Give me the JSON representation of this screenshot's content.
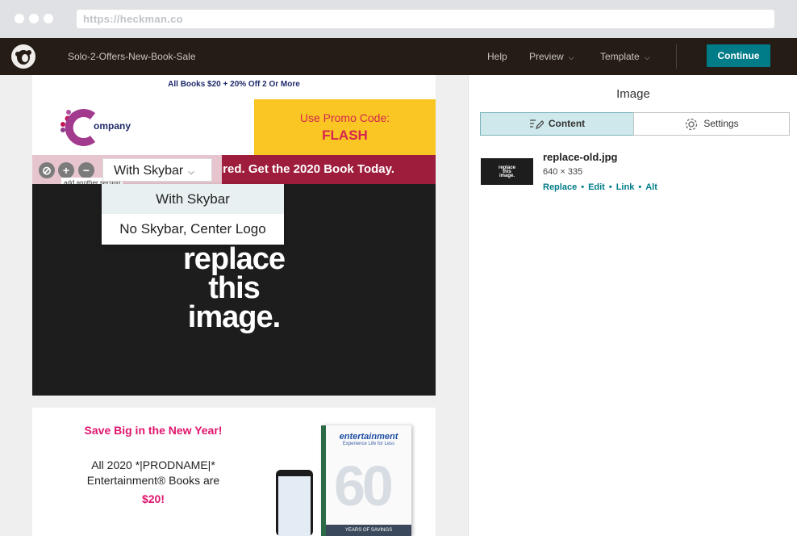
{
  "browser": {
    "url": "https://heckman.co"
  },
  "topbar": {
    "campaign_name": "Solo-2-Offers-New-Book-Sale",
    "nav": [
      {
        "label": "Help",
        "has_chevron": false
      },
      {
        "label": "Preview",
        "has_chevron": true
      },
      {
        "label": "Template",
        "has_chevron": true
      }
    ],
    "continue_label": "Continue"
  },
  "email": {
    "preheader": "All Books $20 + 20% Off 2 Or More",
    "company_text": "ompany",
    "promo_line1": "Use Promo Code:",
    "promo_code": "FLASH",
    "skybar_text": "ired. Get the 2020 Book Today.",
    "section_tooltip": "add another section",
    "layout_select": {
      "value": "With Skybar",
      "options": [
        "With Skybar",
        "No Skybar, Center Logo"
      ]
    },
    "hero_lines": [
      "replace",
      "this",
      "image."
    ],
    "offer": {
      "title": "Save Big in the New Year!",
      "line1": "All 2020 *|PRODNAME|*",
      "line2": "Entertainment® Books are",
      "price": "$20!",
      "book_title": "entertainment",
      "book_sub": "Experience Life for Less",
      "book_band": "YEARS OF SAVINGS"
    }
  },
  "panel": {
    "title": "Image",
    "tabs": [
      {
        "label": "Content",
        "active": true
      },
      {
        "label": "Settings",
        "active": false
      }
    ],
    "image": {
      "filename": "replace-old.jpg",
      "dimensions": "640 × 335",
      "thumb_text": [
        "replace",
        "this",
        "image."
      ],
      "actions": [
        "Replace",
        "Edit",
        "Link",
        "Alt"
      ]
    }
  },
  "colors": {
    "brand_teal": "#007c89",
    "topbar_bg": "#241c15",
    "promo_yellow": "#f9c623",
    "skybar": "#9e1d3c",
    "accent_pink": "#e0156d"
  }
}
